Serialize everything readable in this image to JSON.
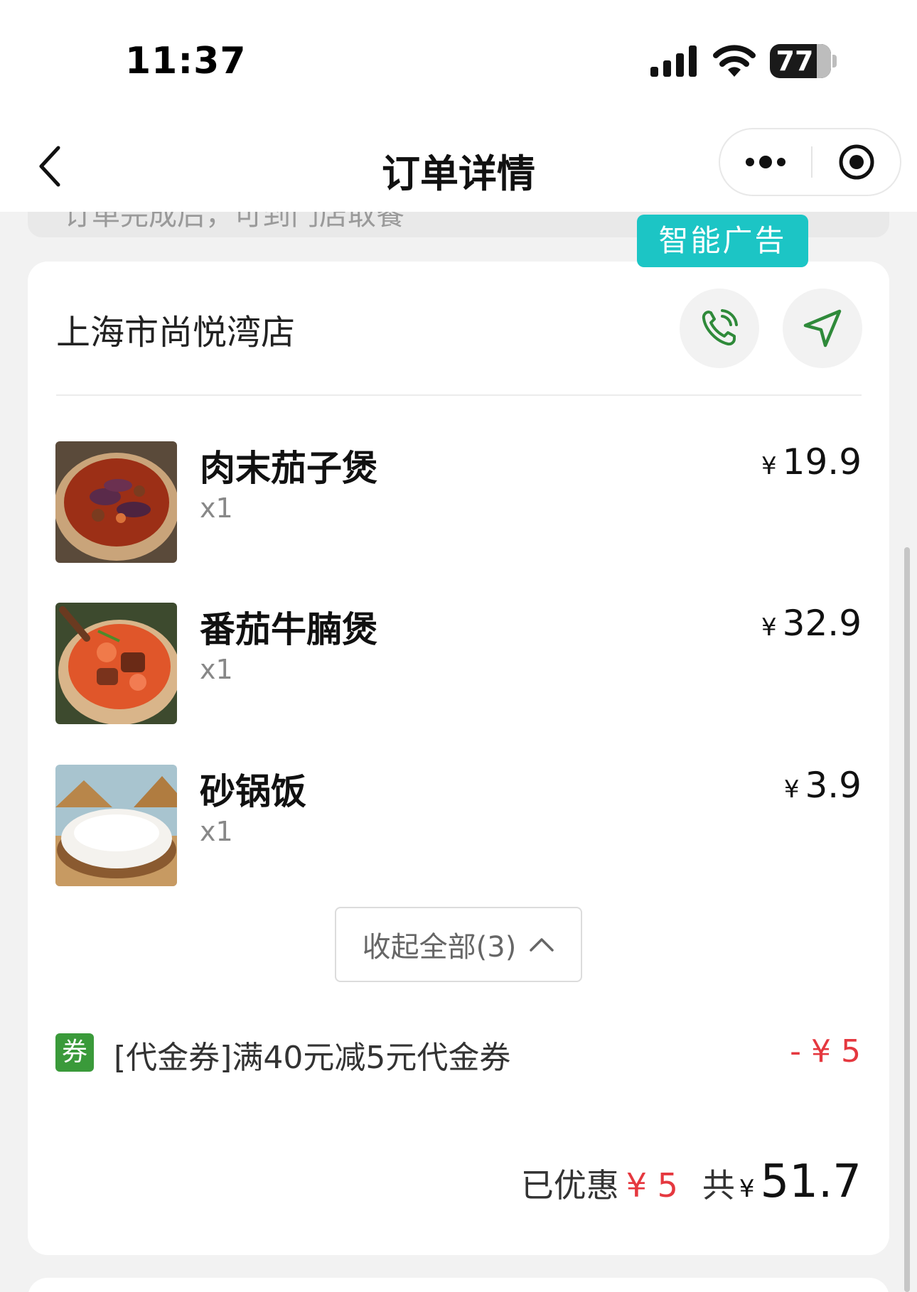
{
  "status_bar": {
    "time": "11:37",
    "battery": "77"
  },
  "header": {
    "title": "订单详情"
  },
  "top_card": {
    "text": "订单完成后，可到门店取餐"
  },
  "ad": {
    "label": "智能广告"
  },
  "store": {
    "name": "上海市尚悦湾店"
  },
  "items": [
    {
      "name": "肉末茄子煲",
      "qty": "x1",
      "currency": "¥",
      "price": "19.9"
    },
    {
      "name": "番茄牛腩煲",
      "qty": "x1",
      "currency": "¥",
      "price": "32.9"
    },
    {
      "name": "砂锅饭",
      "qty": "x1",
      "currency": "¥",
      "price": "3.9"
    }
  ],
  "collapse": {
    "label": "收起全部(3)"
  },
  "coupon": {
    "tag": "券",
    "desc": "[代金券]满40元减5元代金券",
    "amount": "- ¥ 5"
  },
  "summary": {
    "saved_label": "已优惠",
    "saved_amount": "¥ 5",
    "total_label": "共",
    "currency": "¥",
    "total": "51.7"
  },
  "colors": {
    "accent_green": "#3a9a3a",
    "ad_teal": "#1cc5c5",
    "price_red": "#e5383f"
  }
}
